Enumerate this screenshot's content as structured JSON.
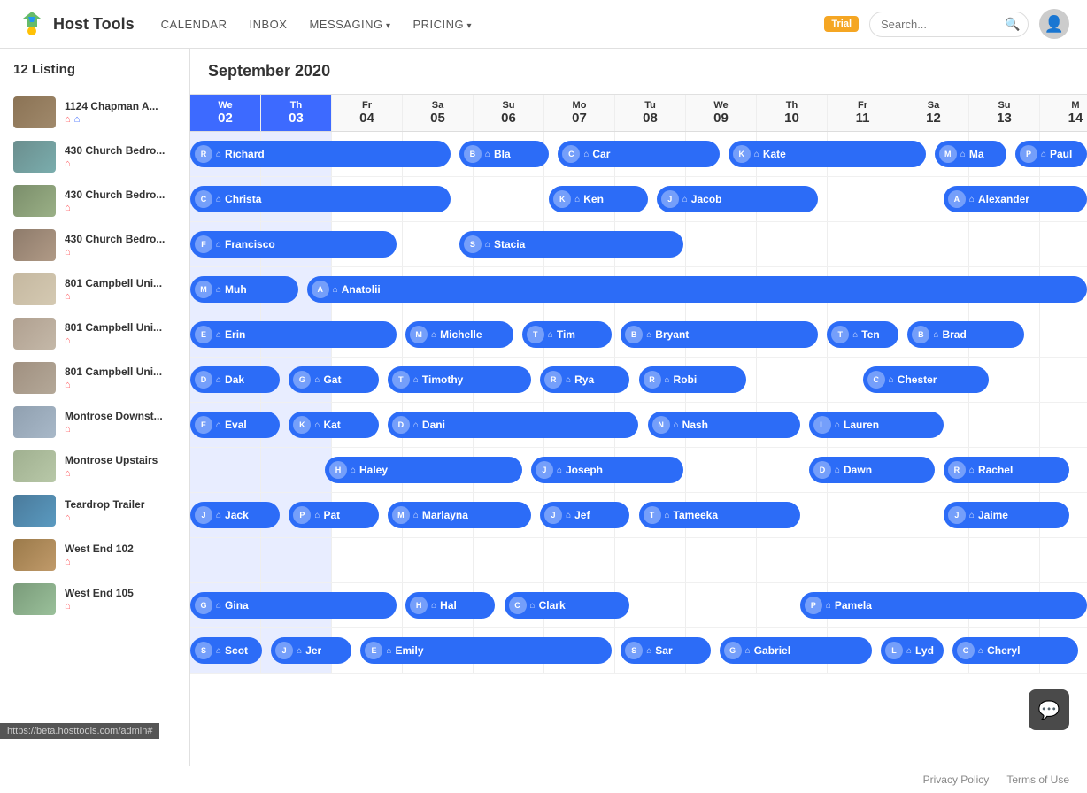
{
  "header": {
    "logo_text": "Host Tools",
    "nav": [
      "CALENDAR",
      "INBOX",
      "MESSAGING",
      "PRICING"
    ],
    "nav_arrows": [
      false,
      false,
      true,
      true
    ],
    "trial_badge": "Trial",
    "search_placeholder": "Search...",
    "avatar_icon": "👤"
  },
  "sidebar": {
    "title": "12 Listing",
    "listings": [
      {
        "name": "1124 Chapman A...",
        "has_vrbo": true,
        "thumb": "thumb-1"
      },
      {
        "name": "430 Church Bedro...",
        "has_vrbo": false,
        "thumb": "thumb-2"
      },
      {
        "name": "430 Church Bedro...",
        "has_vrbo": false,
        "thumb": "thumb-3"
      },
      {
        "name": "430 Church Bedro...",
        "has_vrbo": false,
        "thumb": "thumb-4"
      },
      {
        "name": "801 Campbell Uni...",
        "has_vrbo": false,
        "thumb": "thumb-5"
      },
      {
        "name": "801 Campbell Uni...",
        "has_vrbo": false,
        "thumb": "thumb-6"
      },
      {
        "name": "801 Campbell Uni...",
        "has_vrbo": false,
        "thumb": "thumb-7"
      },
      {
        "name": "Montrose Downst...",
        "has_vrbo": false,
        "thumb": "thumb-8"
      },
      {
        "name": "Montrose Upstairs",
        "has_vrbo": false,
        "thumb": "thumb-9"
      },
      {
        "name": "Teardrop Trailer",
        "has_vrbo": false,
        "thumb": "thumb-10"
      },
      {
        "name": "West End 102",
        "has_vrbo": false,
        "thumb": "thumb-11"
      },
      {
        "name": "West End 105",
        "has_vrbo": false,
        "thumb": "thumb-12"
      }
    ]
  },
  "calendar": {
    "month_label": "September 2020",
    "days": [
      {
        "name": "We",
        "num": "02",
        "highlight": true
      },
      {
        "name": "Th",
        "num": "03",
        "highlight": true
      },
      {
        "name": "Fr",
        "num": "04"
      },
      {
        "name": "Sa",
        "num": "05"
      },
      {
        "name": "Su",
        "num": "06"
      },
      {
        "name": "Mo",
        "num": "07"
      },
      {
        "name": "Tu",
        "num": "08"
      },
      {
        "name": "We",
        "num": "09"
      },
      {
        "name": "Th",
        "num": "10"
      },
      {
        "name": "Fr",
        "num": "11"
      },
      {
        "name": "Sa",
        "num": "12"
      },
      {
        "name": "Su",
        "num": "13"
      },
      {
        "name": "M",
        "num": "14"
      }
    ]
  },
  "footer": {
    "privacy": "Privacy Policy",
    "terms": "Terms of Use"
  },
  "status_bar": "https://beta.hosttools.com/admin#",
  "chat_icon": "💬"
}
